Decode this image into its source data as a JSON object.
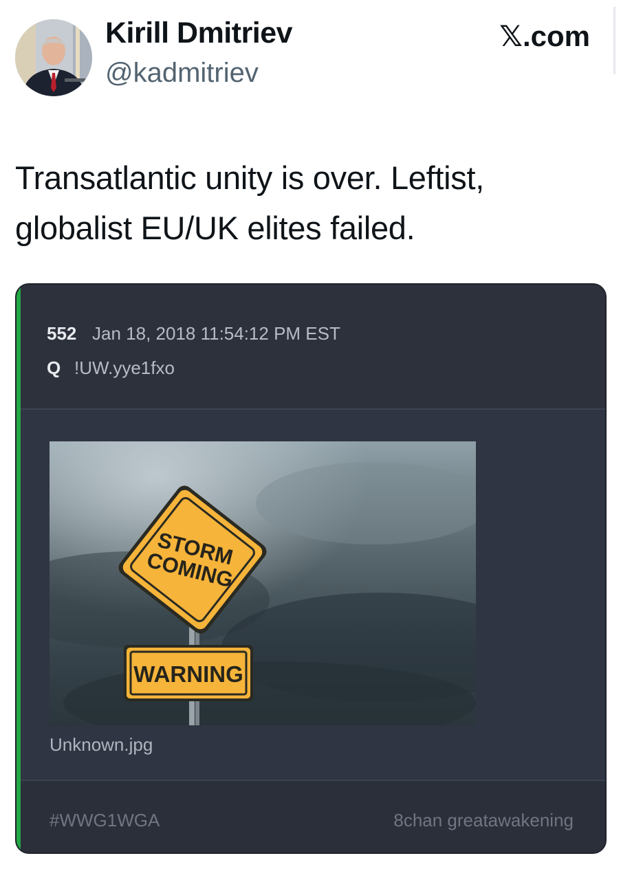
{
  "header": {
    "author_name": "Kirill Dmitriev",
    "author_handle": "@kadmitriev",
    "site_badge_mark": "𝕏",
    "site_badge_suffix": ".com"
  },
  "tweet": {
    "text_line1": "Transatlantic unity is over. Leftist,",
    "text_line2": "globalist EU/UK elites failed."
  },
  "embedded_post": {
    "accent_color": "#23a845",
    "post_number": "552",
    "timestamp": "Jan 18, 2018 11:54:12 PM EST",
    "poster_name": "Q",
    "tripcode": "!UW.yye1fxo",
    "image": {
      "sign_line1": "STORM",
      "sign_line2": "COMING",
      "plate_text": "WARNING",
      "caption": "Unknown.jpg"
    },
    "footer": {
      "hashtag": "#WWG1WGA",
      "board": "8chan greatawakening"
    }
  }
}
